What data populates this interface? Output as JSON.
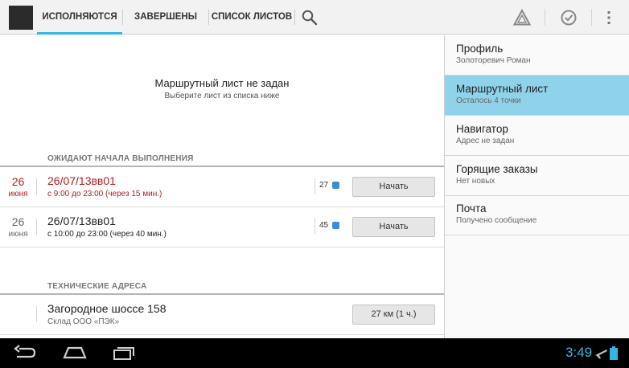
{
  "colors": {
    "accent": "#33b5e5",
    "drawer_active": "#8fd3ea",
    "urgent_red": "#b21e1e",
    "status_bar": "#000000"
  },
  "tabs": [
    {
      "label": "ИСПОЛНЯЮТСЯ",
      "active": true
    },
    {
      "label": "ЗАВЕРШЕНЫ",
      "active": false
    },
    {
      "label": "СПИСОК ЛИСТОВ",
      "active": false
    }
  ],
  "icons": {
    "search": "search-icon",
    "warning": "warning-triangle-icon",
    "check": "check-circle-icon",
    "overflow": "overflow-menu-icon"
  },
  "main": {
    "empty_title": "Маршрутный лист не задан",
    "empty_subtitle": "Выберите лист из списка ниже",
    "pending_section": "ОЖИДАЮТ НАЧАЛА ВЫПОЛНЕНИЯ",
    "pending": [
      {
        "day": "26",
        "month": "июня",
        "title": "26/07/13вв01",
        "subtitle": "с 9:00 до 23:00 (через 15 мин.)",
        "count": "27",
        "button": "Начать",
        "urgent": true
      },
      {
        "day": "26",
        "month": "июня",
        "title": "26/07/13вв01",
        "subtitle": "с 10:00 до 23:00 (через 40 мин.)",
        "count": "45",
        "button": "Начать",
        "urgent": false
      }
    ],
    "tech_section": "ТЕХНИЧЕСКИЕ АДРЕСА",
    "tech": [
      {
        "title": "Загородное шоссе 158",
        "subtitle": "Склад ООО «ПЭК»",
        "button": "27 км (1 ч.)"
      }
    ]
  },
  "drawer": [
    {
      "title": "Профиль",
      "subtitle": "Золоторевич Роман",
      "active": false
    },
    {
      "title": "Маршрутный лист",
      "subtitle": "Осталось 4 точки",
      "active": true
    },
    {
      "title": "Навигатор",
      "subtitle": "Адрес не задан",
      "active": false
    },
    {
      "title": "Горящие заказы",
      "subtitle": "Нет новых",
      "active": false
    },
    {
      "title": "Почта",
      "subtitle": "Получено сообщение",
      "active": false
    }
  ],
  "system_bar": {
    "time": "3:49",
    "buttons": [
      "back-icon",
      "home-icon",
      "recent-apps-icon"
    ],
    "status_icons": [
      "airplane-mode-icon",
      "battery-icon"
    ]
  }
}
